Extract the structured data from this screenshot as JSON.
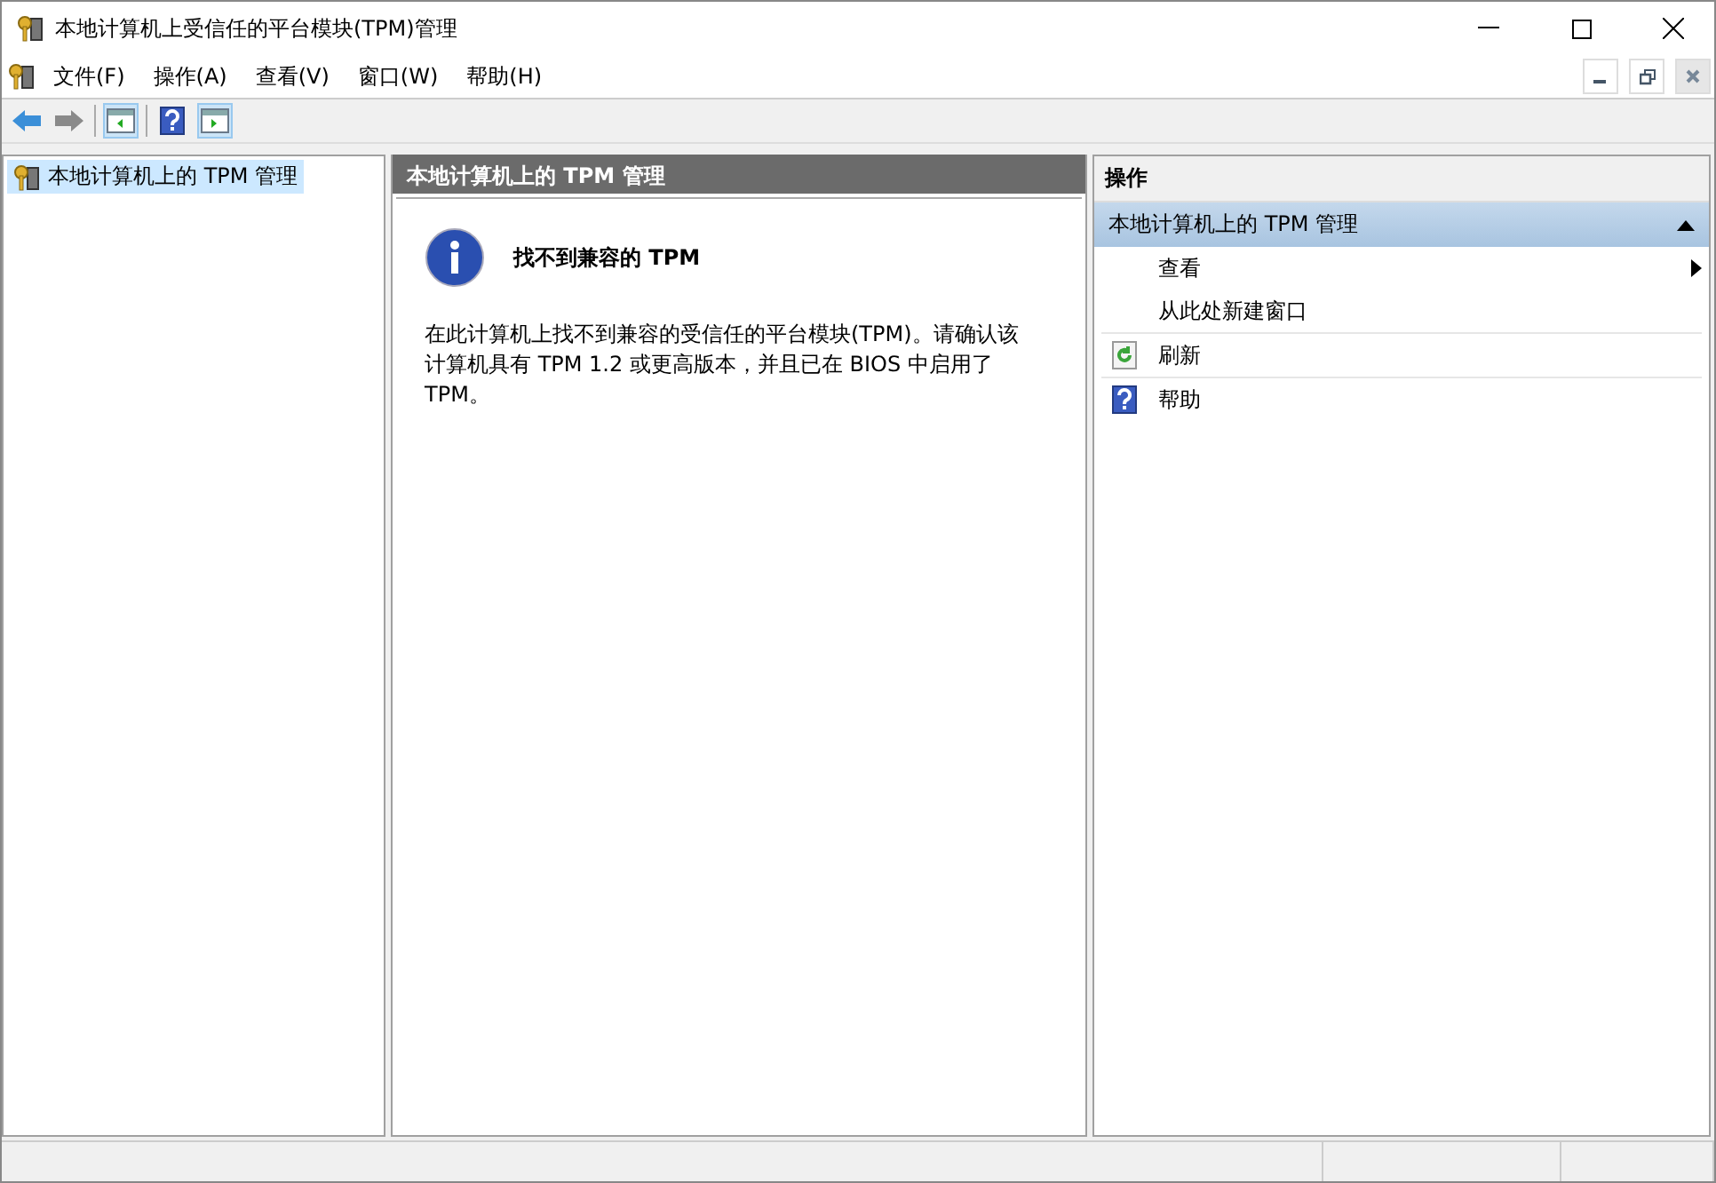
{
  "window": {
    "title": "本地计算机上受信任的平台模块(TPM)管理"
  },
  "menu": [
    "文件(F)",
    "操作(A)",
    "查看(V)",
    "窗口(W)",
    "帮助(H)"
  ],
  "tree": [
    {
      "label": "本地计算机上的 TPM 管理",
      "selected": true
    }
  ],
  "center": {
    "header": "本地计算机上的 TPM 管理",
    "message_title": "找不到兼容的 TPM",
    "message": "在此计算机上找不到兼容的受信任的平台模块(TPM)。请确认该计算机具有 TPM 1.2 或更高版本，并且已在 BIOS 中启用了 TPM。"
  },
  "actions": {
    "header": "操作",
    "section": {
      "title": "本地计算机上的 TPM 管理",
      "expanded": true
    },
    "items": [
      {
        "label": "查看",
        "kind": "submenu"
      },
      {
        "label": "从此处新建窗口",
        "kind": "command"
      },
      {
        "label": "刷新",
        "kind": "refresh"
      },
      {
        "label": "帮助",
        "kind": "help"
      }
    ]
  }
}
